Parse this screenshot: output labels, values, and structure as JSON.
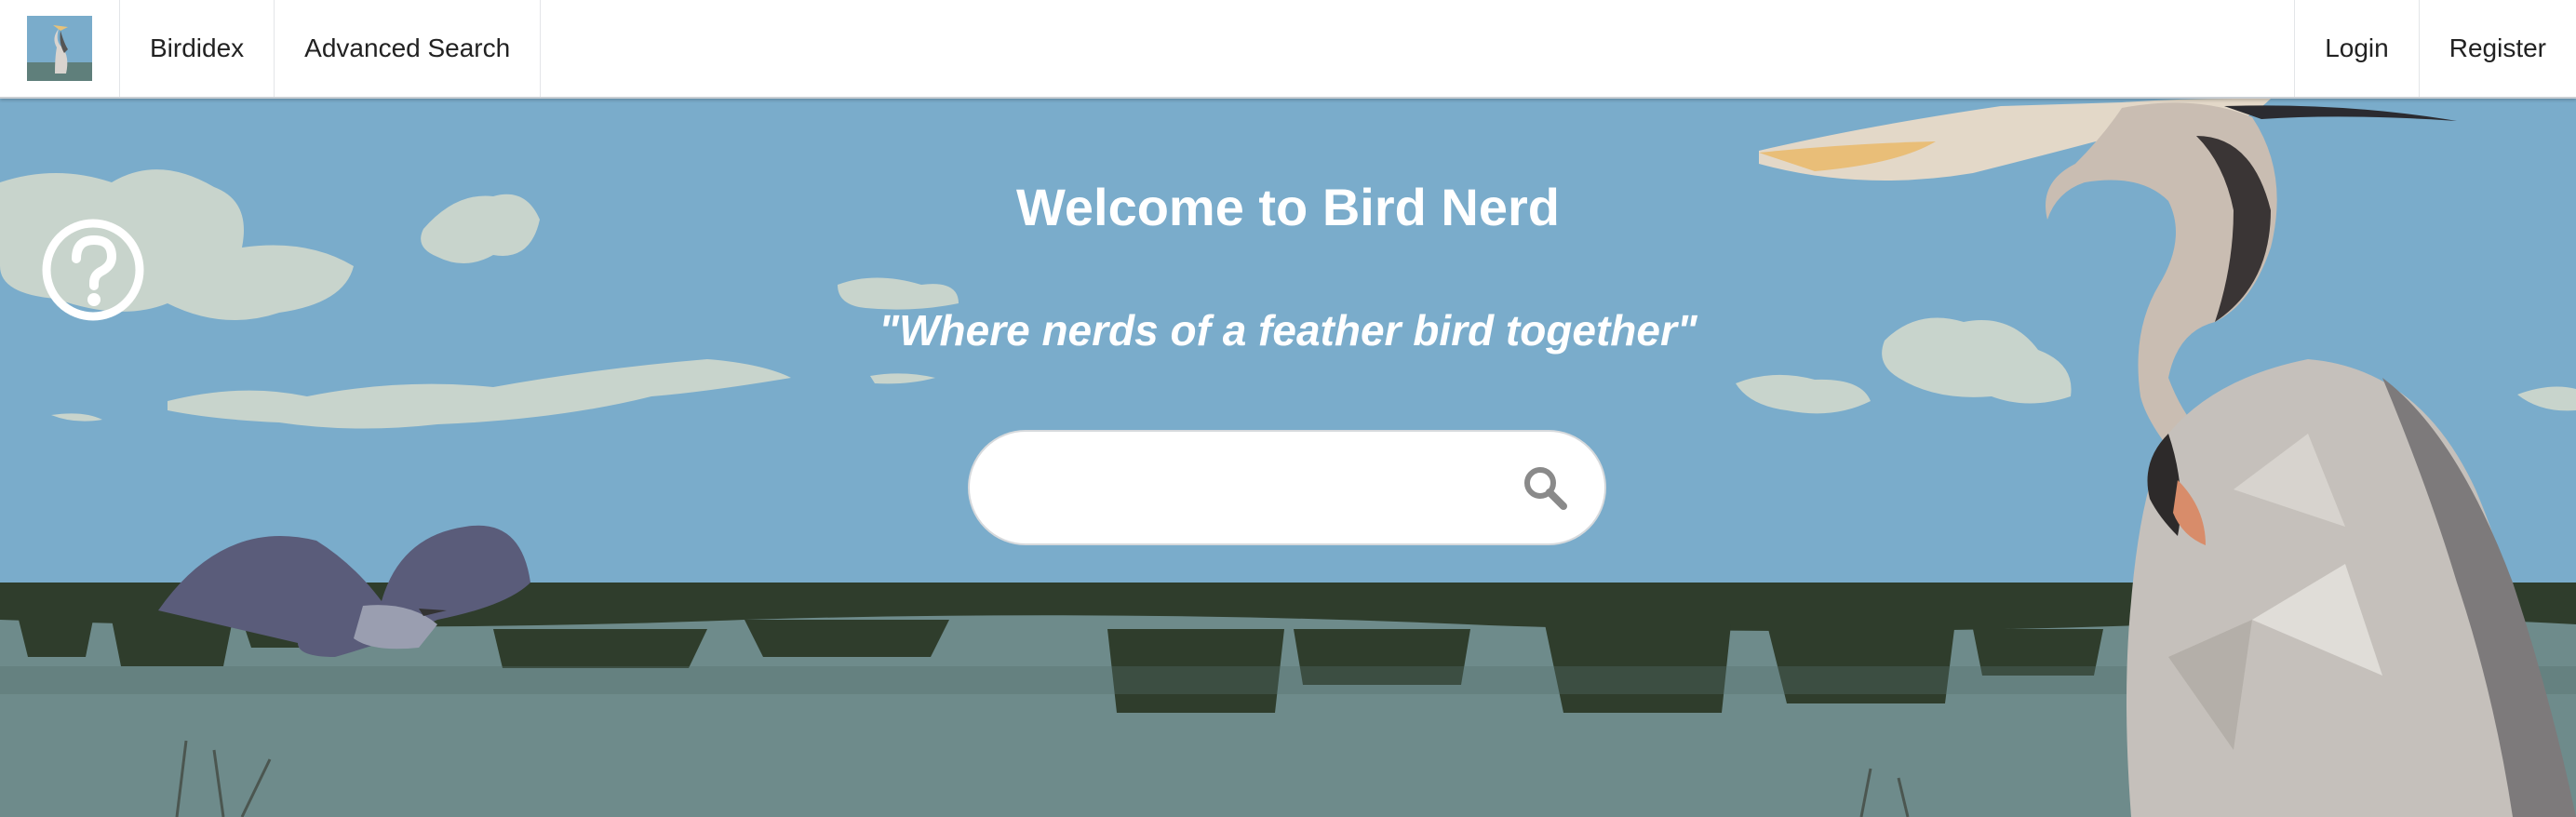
{
  "nav": {
    "logo_icon": "heron-logo-icon",
    "items": [
      {
        "label": "Birdidex"
      },
      {
        "label": "Advanced Search"
      }
    ],
    "right_items": [
      {
        "label": "Login"
      },
      {
        "label": "Register"
      }
    ]
  },
  "hero": {
    "title": "Welcome to Bird Nerd",
    "subtitle": "\"Where nerds of a feather bird together\""
  },
  "search": {
    "value": "",
    "placeholder": "",
    "icon": "search-icon"
  },
  "help": {
    "icon": "help-question-icon"
  },
  "colors": {
    "sky": "#7aaccb",
    "water": "#6e8b8b",
    "reeds": "#2f3d2c",
    "cloud": "#c8d4cc",
    "text_on_image": "#ffffff"
  }
}
